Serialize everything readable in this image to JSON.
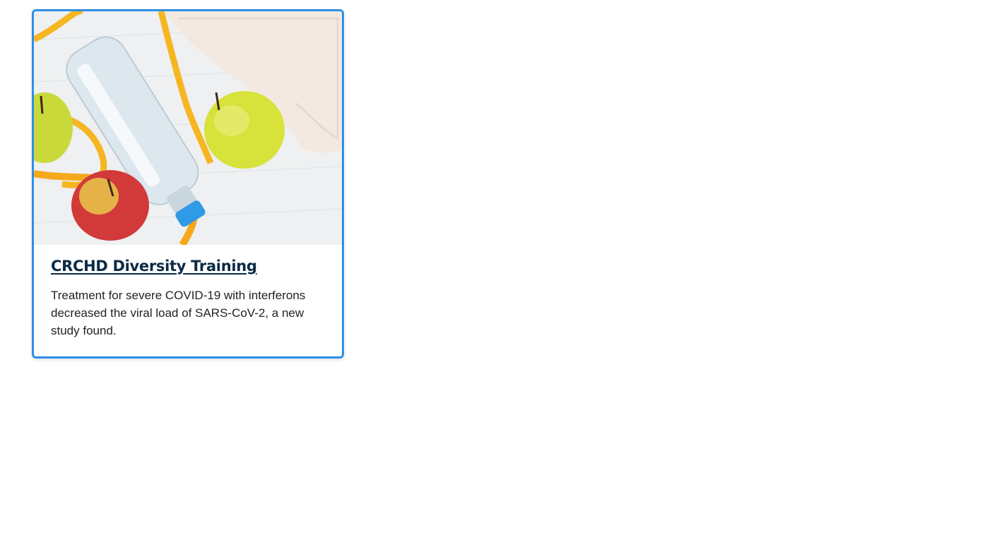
{
  "card": {
    "title": "CRCHD Diversity Training",
    "description": "Treatment for severe COVID-19 with interferons decreased the viral load of SARS-CoV-2, a new study found.",
    "image_subject": "water bottle, apples, measuring tape and towel",
    "border_color": "#2e8fe8",
    "title_color": "#0b2a45"
  }
}
